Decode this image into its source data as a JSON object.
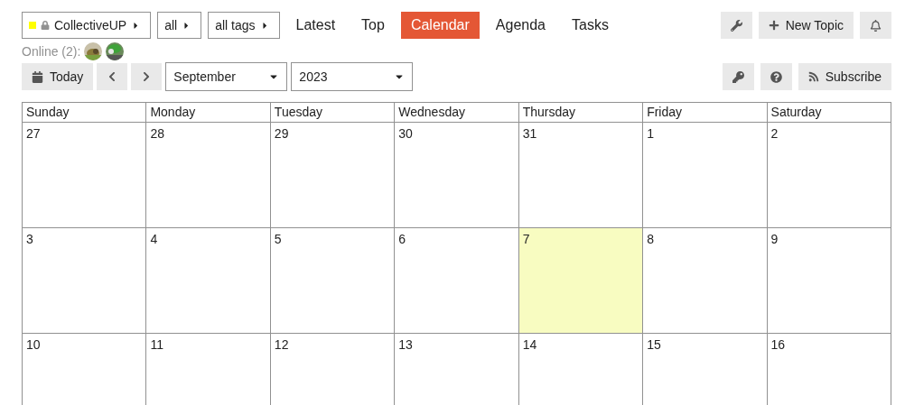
{
  "nav": {
    "category": {
      "label": "CollectiveUP",
      "color": "#ffff00",
      "locked": true
    },
    "filters": [
      "all",
      "all tags"
    ],
    "tabs": [
      {
        "label": "Latest",
        "selected": false
      },
      {
        "label": "Top",
        "selected": false
      },
      {
        "label": "Calendar",
        "selected": true
      },
      {
        "label": "Agenda",
        "selected": false
      },
      {
        "label": "Tasks",
        "selected": false
      }
    ],
    "new_topic": "New Topic"
  },
  "online": {
    "label": "Online (2):"
  },
  "toolbar": {
    "today": "Today",
    "month": "September",
    "year": "2023",
    "subscribe": "Subscribe"
  },
  "calendar": {
    "weekdays": [
      "Sunday",
      "Monday",
      "Tuesday",
      "Wednesday",
      "Thursday",
      "Friday",
      "Saturday"
    ],
    "weeks": [
      [
        {
          "day": "27",
          "today": false
        },
        {
          "day": "28",
          "today": false
        },
        {
          "day": "29",
          "today": false
        },
        {
          "day": "30",
          "today": false
        },
        {
          "day": "31",
          "today": false
        },
        {
          "day": "1",
          "today": false
        },
        {
          "day": "2",
          "today": false
        }
      ],
      [
        {
          "day": "3",
          "today": false
        },
        {
          "day": "4",
          "today": false
        },
        {
          "day": "5",
          "today": false
        },
        {
          "day": "6",
          "today": false
        },
        {
          "day": "7",
          "today": true
        },
        {
          "day": "8",
          "today": false
        },
        {
          "day": "9",
          "today": false
        }
      ],
      [
        {
          "day": "10",
          "today": false
        },
        {
          "day": "11",
          "today": false
        },
        {
          "day": "12",
          "today": false
        },
        {
          "day": "13",
          "today": false
        },
        {
          "day": "14",
          "today": false
        },
        {
          "day": "15",
          "today": false
        },
        {
          "day": "16",
          "today": false
        }
      ]
    ]
  }
}
